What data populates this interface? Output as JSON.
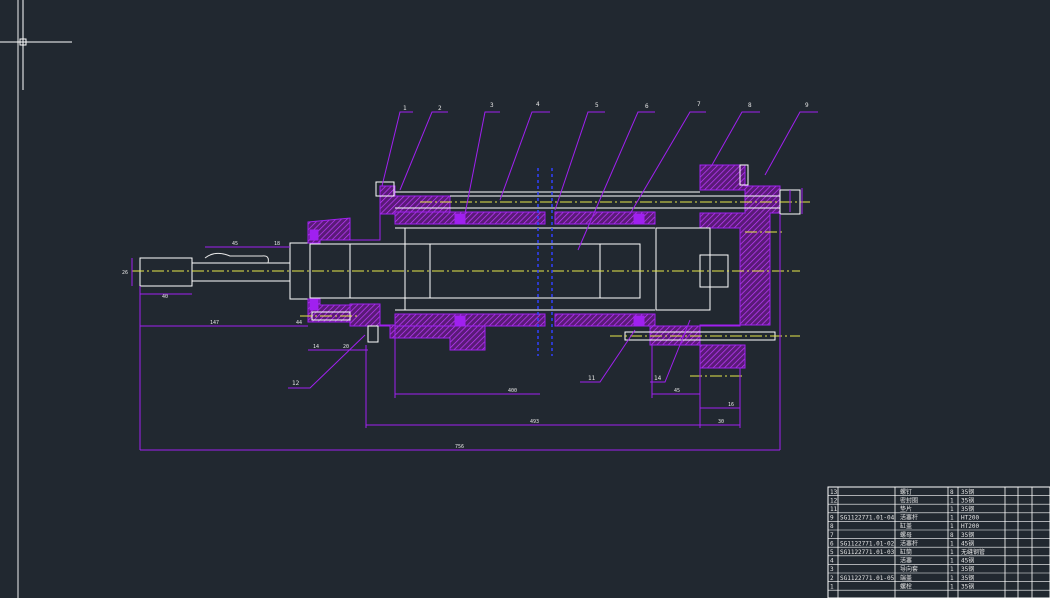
{
  "canvas": {
    "background": "#212830",
    "drawing_color": "#a020f0",
    "centerline_color": "#e8e84a",
    "hatch_color": "#a020f0",
    "text_color": "#e6e6e6",
    "cursor": "crosshair-cursor"
  },
  "callouts": [
    "1",
    "2",
    "3",
    "4",
    "5",
    "6",
    "7",
    "8",
    "9",
    "11",
    "12",
    "14"
  ],
  "dimensions": {
    "d_26": "26",
    "d_40": "40",
    "d_45": "45",
    "d_18": "18",
    "d_147": "147",
    "d_44": "44",
    "d_14": "14",
    "d_20": "20",
    "d_400": "400",
    "d_45b": "45",
    "d_16": "16",
    "d_493": "493",
    "d_30": "30",
    "d_756": "756"
  },
  "bom": {
    "rows": [
      {
        "no": "13",
        "code": "",
        "name": "螺钉",
        "qty": "8",
        "material": "35钢"
      },
      {
        "no": "12",
        "code": "",
        "name": "密封圈",
        "qty": "1",
        "material": "35钢"
      },
      {
        "no": "11",
        "code": "",
        "name": "垫片",
        "qty": "1",
        "material": "35钢"
      },
      {
        "no": "9",
        "code": "SG1122771.01-04",
        "name": "活塞杆",
        "qty": "1",
        "material": "HT200"
      },
      {
        "no": "8",
        "code": "",
        "name": "缸盖",
        "qty": "1",
        "material": "HT200"
      },
      {
        "no": "7",
        "code": "",
        "name": "螺母",
        "qty": "8",
        "material": "35钢"
      },
      {
        "no": "6",
        "code": "SG1122771.01-02",
        "name": "活塞杆",
        "qty": "1",
        "material": "45钢"
      },
      {
        "no": "5",
        "code": "SG1122771.01-03",
        "name": "缸筒",
        "qty": "1",
        "material": "无缝钢管"
      },
      {
        "no": "4",
        "code": "",
        "name": "活塞",
        "qty": "1",
        "material": "45钢"
      },
      {
        "no": "3",
        "code": "",
        "name": "导向套",
        "qty": "1",
        "material": "35钢"
      },
      {
        "no": "2",
        "code": "SG1122771.01-05",
        "name": "端盖",
        "qty": "1",
        "material": "35钢"
      },
      {
        "no": "1",
        "code": "",
        "name": "螺栓",
        "qty": "1",
        "material": "35钢"
      }
    ]
  }
}
